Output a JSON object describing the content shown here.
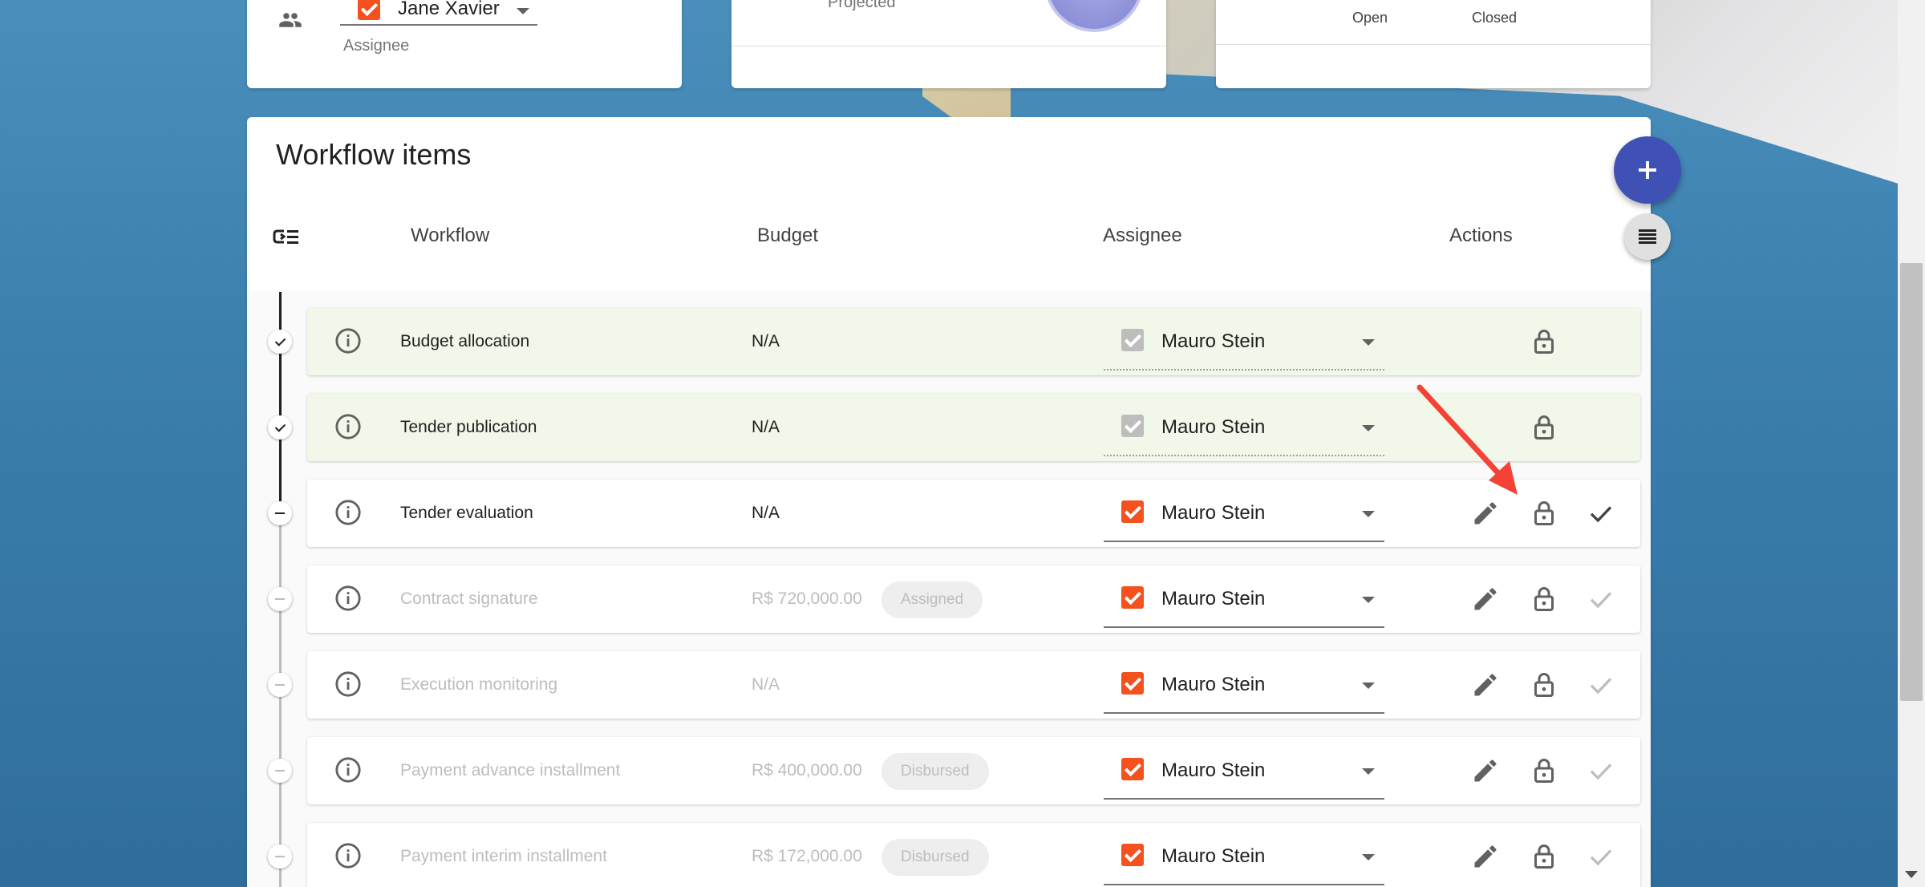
{
  "top_cards": {
    "assignee_card": {
      "selected_name": "Jane Xavier",
      "label": "Assignee"
    },
    "projected_card": {
      "label": "Projected"
    },
    "status_card": {
      "open_label": "Open",
      "closed_label": "Closed"
    }
  },
  "workflow": {
    "title": "Workflow items",
    "columns": {
      "workflow": "Workflow",
      "budget": "Budget",
      "assignee": "Assignee",
      "actions": "Actions"
    },
    "rows": [
      {
        "name": "Budget allocation",
        "budget": "N/A",
        "chip": "",
        "assignee": "Mauro Stein",
        "status": "done",
        "editable": false,
        "completable": false
      },
      {
        "name": "Tender publication",
        "budget": "N/A",
        "chip": "",
        "assignee": "Mauro Stein",
        "status": "done",
        "editable": false,
        "completable": false
      },
      {
        "name": "Tender evaluation",
        "budget": "N/A",
        "chip": "",
        "assignee": "Mauro Stein",
        "status": "active",
        "editable": true,
        "completable": true
      },
      {
        "name": "Contract signature",
        "budget": "R$ 720,000.00",
        "chip": "Assigned",
        "assignee": "Mauro Stein",
        "status": "pending",
        "editable": true,
        "completable": false
      },
      {
        "name": "Execution monitoring",
        "budget": "N/A",
        "chip": "",
        "assignee": "Mauro Stein",
        "status": "pending",
        "editable": true,
        "completable": false
      },
      {
        "name": "Payment advance installment",
        "budget": "R$ 400,000.00",
        "chip": "Disbursed",
        "assignee": "Mauro Stein",
        "status": "pending",
        "editable": true,
        "completable": false
      },
      {
        "name": "Payment interim installment",
        "budget": "R$ 172,000.00",
        "chip": "Disbursed",
        "assignee": "Mauro Stein",
        "status": "pending",
        "editable": true,
        "completable": false
      }
    ]
  },
  "icons": {
    "fab": "plus-icon",
    "fab_small": "list-icon",
    "header_sort": "sort-list-icon",
    "row_info": "info-icon",
    "row_edit": "pencil-icon",
    "row_lock": "lock-open-icon",
    "row_done": "check-icon"
  },
  "colors": {
    "accent": "#3f51b5",
    "checkbox_active": "#f4511e",
    "checkbox_disabled": "#bdbdbd",
    "done_row": "#f1f8e9",
    "annotation_arrow": "#f44336"
  }
}
